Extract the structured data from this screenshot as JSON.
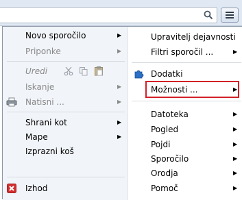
{
  "left_menu": {
    "new_message": "Novo sporočilo",
    "attachments": "Priponke",
    "edit": "Uredi",
    "find": "Iskanje",
    "print": "Natisni ...",
    "save_as": "Shrani kot",
    "folders": "Mape",
    "empty_trash": "Izprazni koš",
    "exit": "Izhod"
  },
  "right_menu": {
    "account_manager": "Upravitelj dejavnosti",
    "message_filters": "Filtri sporočil ...",
    "addons": "Dodatki",
    "options": "Možnosti ...",
    "file": "Datoteka",
    "view": "Pogled",
    "go": "Pojdi",
    "message": "Sporočilo",
    "tools": "Orodja",
    "help": "Pomoč"
  },
  "icons": {
    "search": "search-icon",
    "menu": "hamburger-menu-icon",
    "cut": "scissors-icon",
    "copy": "copy-icon",
    "paste": "clipboard-icon",
    "print": "printer-icon",
    "addons": "puzzle-piece-icon",
    "exit": "close-icon"
  },
  "colors": {
    "highlight_border": "#d32027",
    "addons_icon": "#2b6fc7",
    "exit_icon": "#d32f2f"
  }
}
